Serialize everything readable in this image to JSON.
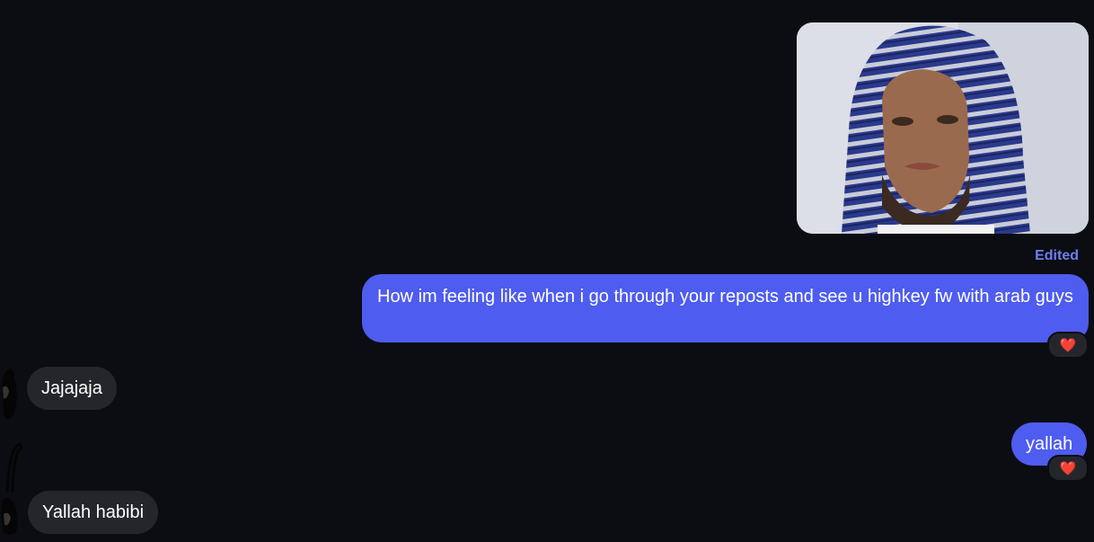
{
  "messages": {
    "edited_label": "Edited",
    "sent_long": "How im feeling like when i go through your reposts and see u highkey fw with arab guys",
    "received_1": "Jajajaja",
    "sent_short": "yallah",
    "received_2": "Yallah habibi"
  },
  "reactions": {
    "first": "❤️",
    "second": "❤️"
  },
  "icons": {
    "reaction": "red-heart-icon"
  },
  "colors": {
    "background": "#0b0d12",
    "sent_bubble": "#4e5cf0",
    "received_bubble": "#25262b",
    "edited_text": "#6e7ff3",
    "heart": "#ff2b3b"
  }
}
